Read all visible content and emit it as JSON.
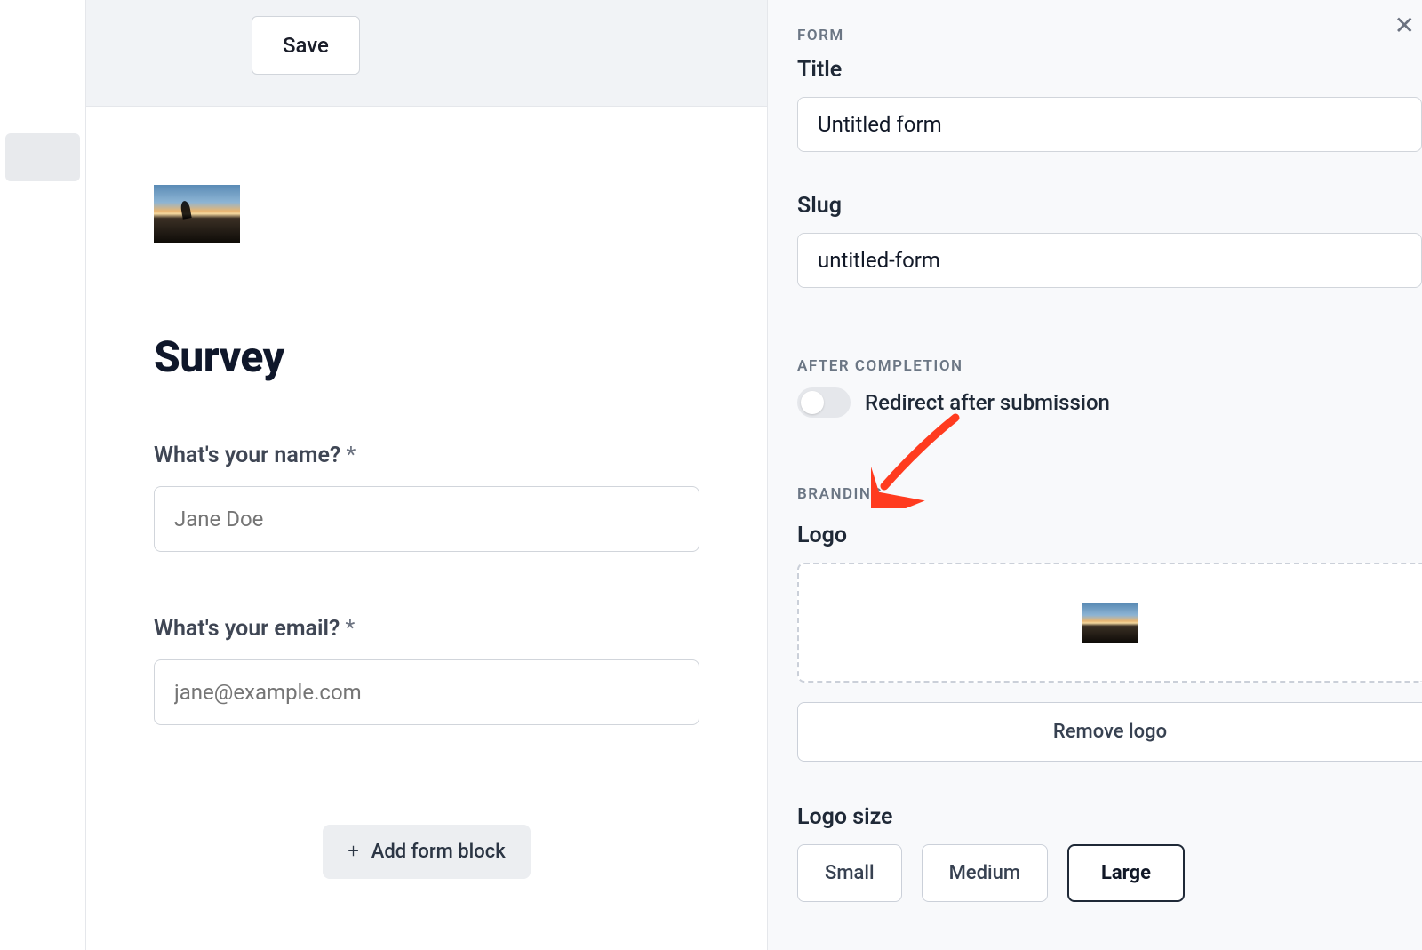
{
  "toolbar": {
    "save_label": "Save"
  },
  "canvas": {
    "form_title": "Survey",
    "fields": [
      {
        "label": "What's your name?",
        "required_mark": "*",
        "placeholder": "Jane Doe"
      },
      {
        "label": "What's your email?",
        "required_mark": "*",
        "placeholder": "jane@example.com"
      }
    ],
    "add_block_label": "Add form block"
  },
  "panel": {
    "form_section": {
      "label": "FORM",
      "title_label": "Title",
      "title_value": "Untitled form",
      "slug_label": "Slug",
      "slug_value": "untitled-form"
    },
    "after_completion": {
      "label": "AFTER COMPLETION",
      "redirect_label": "Redirect after submission",
      "redirect_on": false
    },
    "branding": {
      "label": "BRANDING",
      "logo_label": "Logo",
      "remove_logo_label": "Remove logo",
      "logo_size_label": "Logo size",
      "sizes": {
        "small": "Small",
        "medium": "Medium",
        "large": "Large"
      }
    }
  }
}
